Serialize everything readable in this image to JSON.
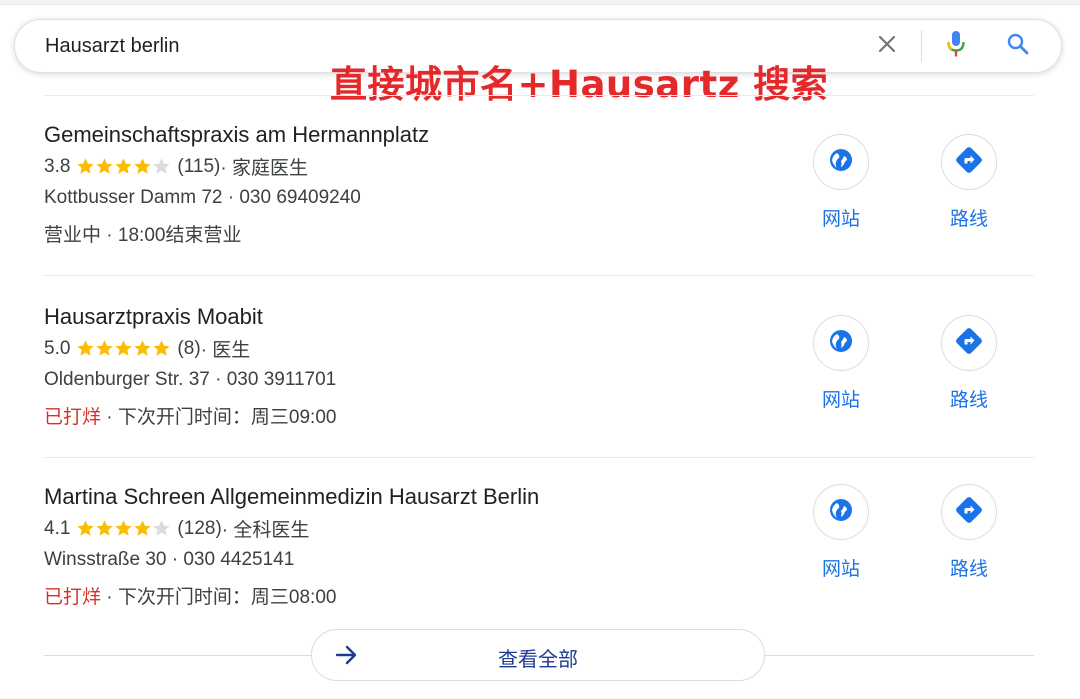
{
  "search": {
    "query": "Hausarzt berlin",
    "clear_icon": "close-icon",
    "mic_icon": "microphone-icon",
    "search_icon": "magnifier-icon"
  },
  "annotation": {
    "text": "直接城市名+Hausartz 搜索",
    "color": "#e5282a"
  },
  "colors": {
    "star": "#fbbc04",
    "star_empty": "#dadce0",
    "action_blue": "#1a73e8",
    "closed_red": "#d93025"
  },
  "results": [
    {
      "name": "Gemeinschaftspraxis am Hermannplatz",
      "rating": "3.8",
      "stars": 3.8,
      "reviews": "(115)",
      "category": " · 家庭医生",
      "address": "Kottbusser Damm 72 · 030 69409240",
      "status": "营业中",
      "status_closed": false,
      "hours": " · 18:00结束营业",
      "website_label": "网站",
      "directions_label": "路线"
    },
    {
      "name": "Hausarztpraxis Moabit",
      "rating": "5.0",
      "stars": 5.0,
      "reviews": "(8)",
      "category": " · 医生",
      "address": "Oldenburger Str. 37 · 030 3911701",
      "status": "已打烊",
      "status_closed": true,
      "hours": " · 下次开门时间：周三09:00",
      "website_label": "网站",
      "directions_label": "路线"
    },
    {
      "name": "Martina Schreen Allgemeinmedizin Hausarzt Berlin",
      "rating": "4.1",
      "stars": 4.1,
      "reviews": "(128)",
      "category": " · 全科医生",
      "address": "Winsstraße 30 · 030 4425141",
      "status": "已打烊",
      "status_closed": true,
      "hours": " · 下次开门时间：周三08:00",
      "website_label": "网站",
      "directions_label": "路线"
    }
  ],
  "view_all": {
    "label": "查看全部",
    "icon": "arrow-right-icon"
  }
}
